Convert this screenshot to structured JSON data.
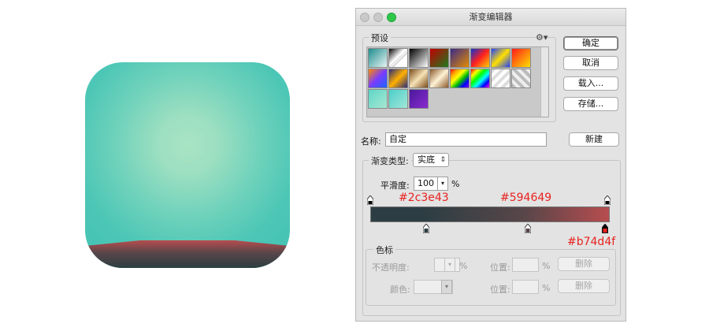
{
  "dialog": {
    "title": "渐变编辑器",
    "presets_label": "预设",
    "settings_icon": "gear-icon",
    "buttons": {
      "ok": "确定",
      "cancel": "取消",
      "load": "载入...",
      "save": "存储...",
      "new": "新建"
    },
    "name_label": "名称:",
    "name_value": "自定",
    "gradient_type_label": "渐变类型:",
    "gradient_type_value": "实底",
    "smoothness_label": "平滑度:",
    "smoothness_value": "100",
    "smoothness_unit": "%",
    "stops": {
      "group_label": "色标",
      "opacity_label": "不透明度:",
      "opacity_unit": "%",
      "opacity_location_label": "位置:",
      "opacity_location_unit": "%",
      "opacity_delete": "删除",
      "color_label": "颜色:",
      "color_location_label": "位置:",
      "color_location_unit": "%",
      "color_delete": "删除"
    }
  },
  "annotations": {
    "stop_left": "#2c3e43",
    "stop_middle": "#594649",
    "stop_right": "#b74d4f"
  },
  "colors": {
    "stop_left": "#2c3e43",
    "stop_middle": "#594649",
    "stop_right": "#b74d4f",
    "icon_background": "#43c2b4",
    "icon_glow": "#a8e4c4",
    "accent_green": "#2ec849",
    "annotation_red": "#e8221f"
  }
}
